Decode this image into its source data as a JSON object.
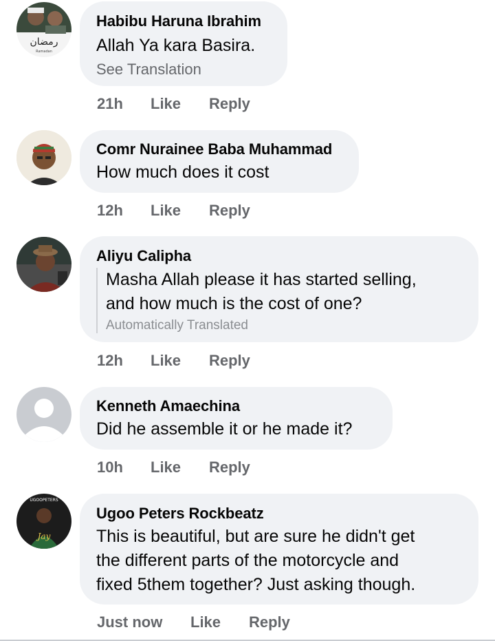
{
  "comments": [
    {
      "author": "Habibu Haruna Ibrahim",
      "text": "Allah Ya kara Basira.",
      "see_translation": "See Translation",
      "time": "21h",
      "like": "Like",
      "reply": "Reply",
      "avatar_icon": "profile-photo-ramadan-banner"
    },
    {
      "author": "Comr Nurainee Baba Muhammad",
      "text": "How much does it cost",
      "time": "12h",
      "like": "Like",
      "reply": "Reply",
      "avatar_icon": "profile-photo-man-cap"
    },
    {
      "author": "Aliyu Calipha",
      "translated_lines": [
        "Masha Allah please it has started selling,",
        "and how much is the cost of one?"
      ],
      "auto_translated": "Automatically Translated",
      "time": "12h",
      "like": "Like",
      "reply": "Reply",
      "avatar_icon": "profile-photo-man-hat"
    },
    {
      "author": "Kenneth Amaechina",
      "text": "Did he assemble it or he made it?",
      "time": "10h",
      "like": "Like",
      "reply": "Reply",
      "avatar_icon": "default-avatar-icon"
    },
    {
      "author": "Ugoo Peters Rockbeatz",
      "lines": [
        "This is beautiful, but are sure he didn't get",
        "the different parts of the motorcycle and",
        "fixed 5them together?  Just asking though."
      ],
      "time": "Just now",
      "like": "Like",
      "reply": "Reply",
      "avatar_icon": "profile-photo-artist"
    }
  ],
  "avatar_text": {
    "ramadan": "رمضان",
    "ramadan_small": "Ramadan",
    "ugoo_top": "UGOOPETERS",
    "ugoo_sig": "Jay"
  },
  "colors": {
    "bubble": "#f0f2f5",
    "meta": "#65676b",
    "text": "#050505"
  }
}
